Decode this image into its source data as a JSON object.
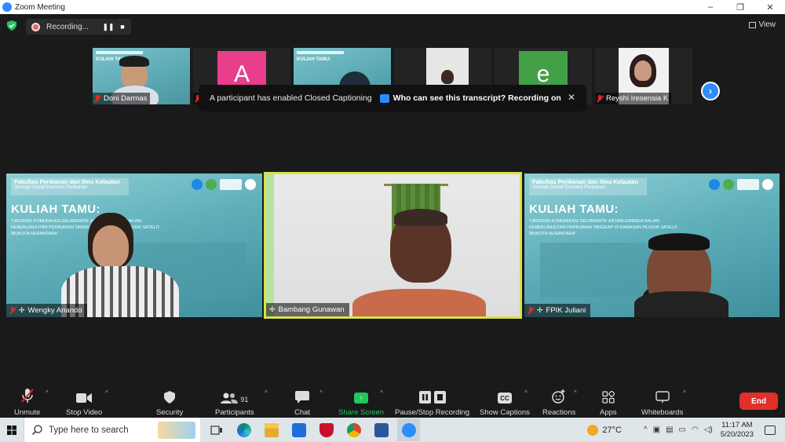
{
  "window": {
    "title": "Zoom Meeting",
    "minimize": "–",
    "restore": "❐",
    "close": "✕"
  },
  "recording": {
    "status": "Recording...",
    "pause": "❚❚",
    "stop": "■"
  },
  "view": {
    "label": "View"
  },
  "thumbnails": [
    {
      "name": "Doni Darmas",
      "type": "video"
    },
    {
      "name": "",
      "type": "avatar",
      "letter": "A",
      "color": "#e83e8c"
    },
    {
      "name": "",
      "type": "video"
    },
    {
      "name": "",
      "type": "video"
    },
    {
      "name": "",
      "type": "avatar",
      "letter": "e",
      "color": "#43a047"
    },
    {
      "name": "Reyshi Iresensia K",
      "type": "video"
    }
  ],
  "toast": {
    "message": "A participant has enabled Closed Captioning",
    "link": "Who can see this transcript? Recording on",
    "close": "✕"
  },
  "slide": {
    "faculty": "Fakultas Perikanan dan Ilmu Kelautan",
    "department": "Jurusan Sosial Ekonomi Perikanan",
    "title": "KULIAH TAMU:",
    "subtitle": "\"URGENSI KOMUNIKASI DELIBERATIF ANTARLEMBAGA DALAM KEBERLANJUTAN PERIKANAN TANGKAP DI KAWASAN PESISIR SATELIT IBUKOTA NUSANTARA\""
  },
  "main_tiles": [
    {
      "name": "Wengky Ariando"
    },
    {
      "name": "Bambang Gunawan"
    },
    {
      "name": "FPIK Juliani"
    }
  ],
  "toolbar": {
    "unmute": "Unmute",
    "stop_video": "Stop Video",
    "security": "Security",
    "participants": "Participants",
    "participants_count": "91",
    "chat": "Chat",
    "share_screen": "Share Screen",
    "pause_stop_recording": "Pause/Stop Recording",
    "show_captions": "Show Captions",
    "cc": "CC",
    "reactions": "Reactions",
    "apps": "Apps",
    "whiteboards": "Whiteboards",
    "end": "End"
  },
  "taskbar": {
    "search_placeholder": "Type here to search",
    "temperature": "27°C",
    "time": "11:17 AM",
    "date": "5/20/2023"
  }
}
